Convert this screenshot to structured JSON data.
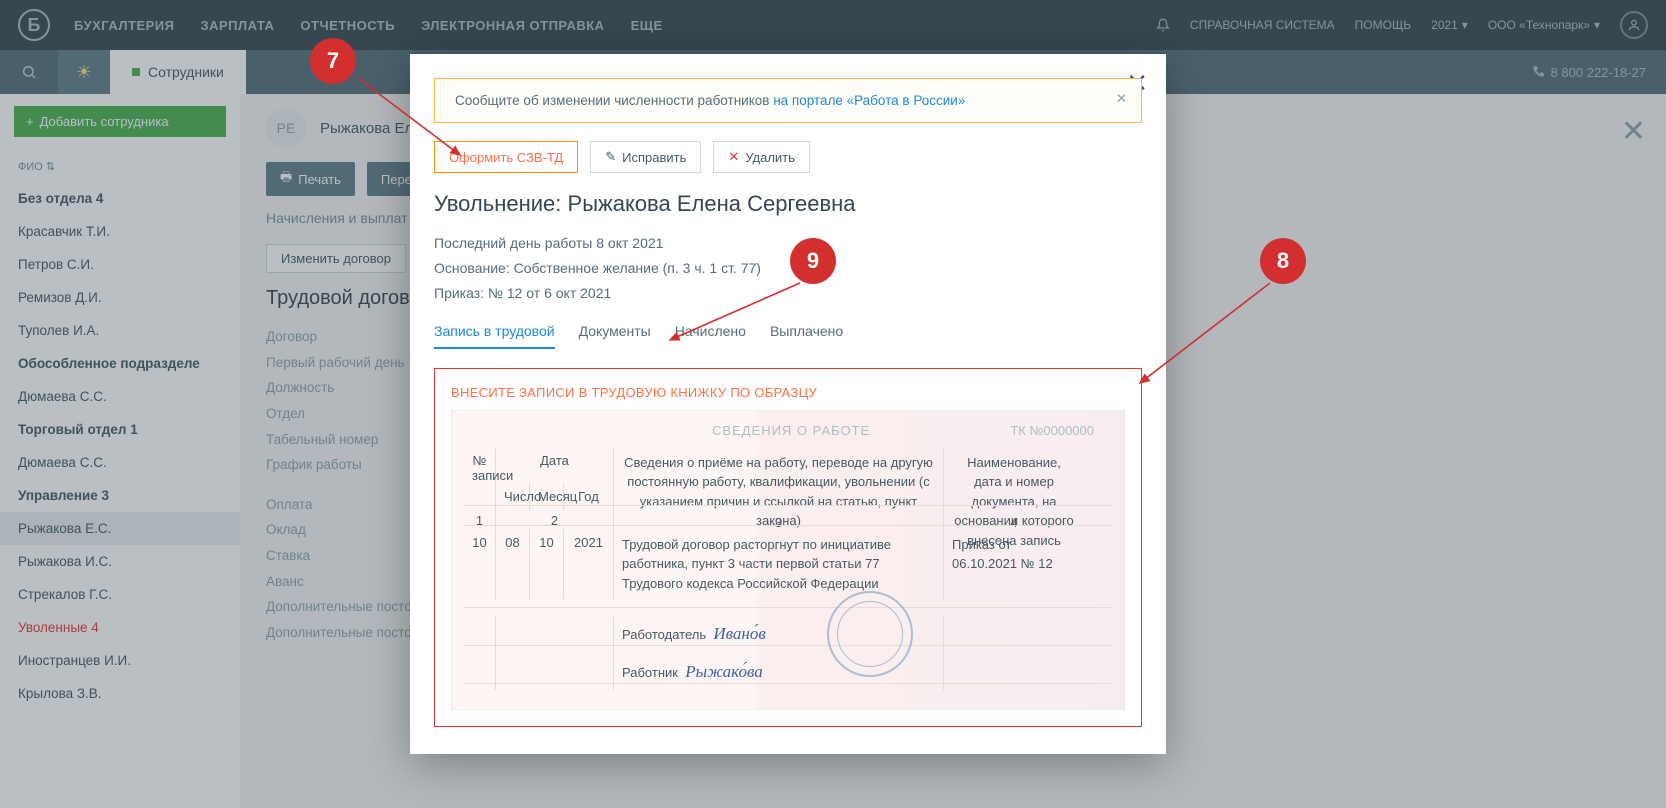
{
  "topnav": {
    "items": [
      "БУХГАЛТЕРИЯ",
      "ЗАРПЛАТА",
      "ОТЧЕТНОСТЬ",
      "ЭЛЕКТРОННАЯ ОТПРАВКА",
      "ЕЩЕ"
    ]
  },
  "topright": {
    "help_system": "СПРАВОЧНАЯ СИСТЕМА",
    "help": "ПОМОЩЬ",
    "year": "2021",
    "org": "ООО «Технопарк»",
    "phone": "8 800 222-18-27"
  },
  "subtab": {
    "label": "Сотрудники"
  },
  "sidebar": {
    "add": "Добавить сотрудника",
    "fio": "ФИО",
    "items": [
      {
        "label": "Без отдела 4",
        "bold": true
      },
      {
        "label": "Красавчик Т.И."
      },
      {
        "label": "Петров С.И."
      },
      {
        "label": "Ремизов Д.И."
      },
      {
        "label": "Туполев И.А."
      },
      {
        "label": "Обособленное подразделе",
        "bold": true
      },
      {
        "label": "Дюмаева С.С."
      },
      {
        "label": "Торговый отдел 1",
        "bold": true
      },
      {
        "label": "Дюмаева С.С."
      },
      {
        "label": "Управление 3",
        "bold": true
      },
      {
        "label": "Рыжакова Е.С.",
        "sel": true
      },
      {
        "label": "Рыжакова И.С."
      },
      {
        "label": "Стрекалов Г.С."
      },
      {
        "label": "Уволенные 4",
        "red": true
      },
      {
        "label": "Иностранцев И.И."
      },
      {
        "label": "Крылова З.В."
      }
    ]
  },
  "content": {
    "emp_initials": "РЕ",
    "emp_name": "Рыжакова Еле",
    "print": "Печать",
    "recalc": "Перера",
    "tabs": "Начисления и выплат",
    "change": "Изменить договор",
    "h2": "Трудовой догово",
    "meta": [
      "Договор",
      "Первый рабочий день",
      "Должность",
      "Отдел",
      "Табельный номер",
      "График работы",
      "",
      "Оплата",
      "Оклад",
      "Ставка",
      "Аванс",
      "Дополнительные постоя\nначисления",
      "Дополнительные постоя\nудержания"
    ]
  },
  "modal": {
    "alert_text": "Сообщите об изменении численности работников ",
    "alert_link": "на портале «Работа в России»",
    "btn_szv": "Оформить СЗВ-ТД",
    "btn_fix": "Исправить",
    "btn_del": "Удалить",
    "title": "Увольнение: Рыжакова Елена Сергеевна",
    "last_day": "Последний день работы 8 окт 2021",
    "reason": "Основание: Собственное желание (п. 3 ч. 1 ст. 77)",
    "order": "Приказ: № 12 от 6 окт 2021",
    "tabs": [
      "Запись в трудовой",
      "Документы",
      "Начислено",
      "Выплачено"
    ],
    "book_head": "ВНЕСИТЕ ЗАПИСИ В ТРУДОВУЮ КНИЖКУ ПО ОБРАЗЦУ",
    "book": {
      "title": "СВЕДЕНИЯ О РАБОТЕ",
      "num": "ТК №0000000",
      "col_date": "Дата",
      "col_info": "Сведения о приёме на работу, переводе на другую постоянную работу, квалификации, увольнении (с указанием причин и ссылкой на статью, пункт закона)",
      "col_doc": "Наименование, дата и номер документа, на основании которого внесена запись",
      "sub": [
        "Число",
        "Месяц",
        "Год"
      ],
      "row": {
        "n": "10",
        "d": "08",
        "m": "10",
        "y": "2021",
        "text": "Трудовой договор расторгнут по инициативе работника, пункт 3 части первой статьи 77 Трудового кодекса Российской Федерации",
        "doc": "Приказ от 06.10.2021 № 12",
        "employer": "Работодатель",
        "employee": "Работник"
      }
    }
  },
  "callouts": {
    "c7": "7",
    "c8": "8",
    "c9": "9"
  }
}
